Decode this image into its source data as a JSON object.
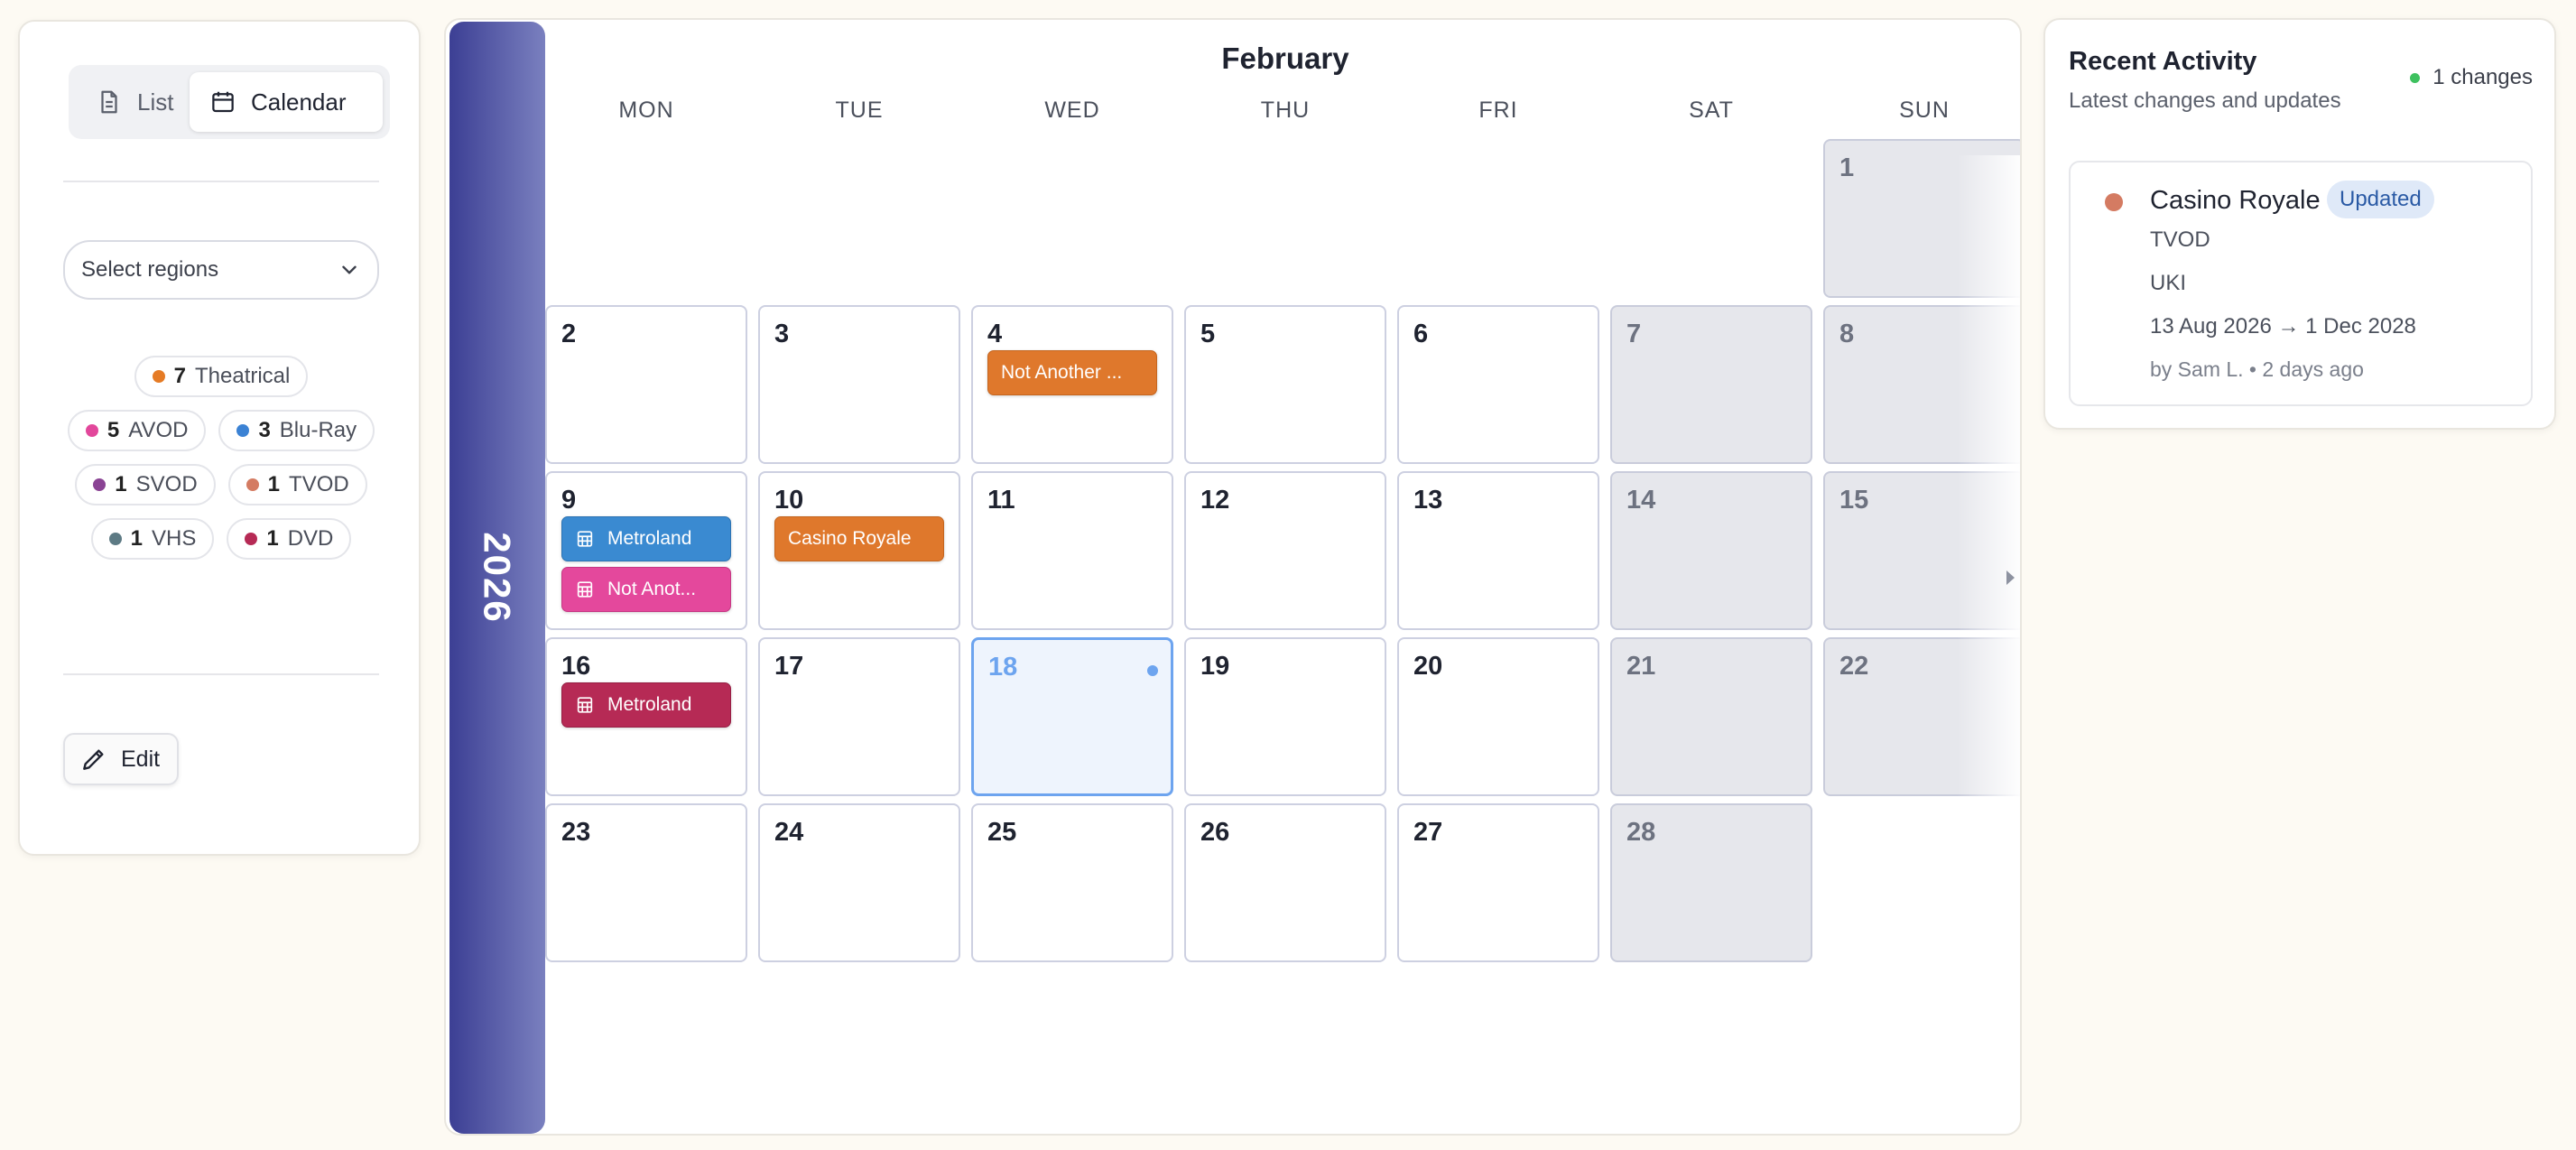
{
  "view_toggle": {
    "list_label": "List",
    "calendar_label": "Calendar",
    "active": "calendar"
  },
  "filters": {
    "region_placeholder": "Select regions",
    "legend": [
      {
        "count": "7",
        "label": "Theatrical",
        "color": "#e57b25"
      },
      {
        "count": "5",
        "label": "AVOD",
        "color": "#e2479b"
      },
      {
        "count": "3",
        "label": "Blu-Ray",
        "color": "#3b82d4"
      },
      {
        "count": "1",
        "label": "SVOD",
        "color": "#8a4394"
      },
      {
        "count": "1",
        "label": "TVOD",
        "color": "#d47b62"
      },
      {
        "count": "1",
        "label": "VHS",
        "color": "#5d7a84"
      },
      {
        "count": "1",
        "label": "DVD",
        "color": "#b62a55"
      }
    ],
    "edit_label": "Edit"
  },
  "calendar": {
    "year": "2026",
    "month": "February",
    "weekdays": [
      "MON",
      "TUE",
      "WED",
      "THU",
      "FRI",
      "SAT",
      "SUN"
    ],
    "today": 18,
    "days": [
      {
        "day": 1,
        "weekend": true,
        "events": []
      },
      {
        "day": 2,
        "weekend": false,
        "events": []
      },
      {
        "day": 3,
        "weekend": false,
        "events": []
      },
      {
        "day": 4,
        "weekend": false,
        "events": [
          {
            "title": "Not Another ...",
            "color": "orange",
            "icon": false
          }
        ]
      },
      {
        "day": 5,
        "weekend": false,
        "events": []
      },
      {
        "day": 6,
        "weekend": false,
        "events": []
      },
      {
        "day": 7,
        "weekend": true,
        "events": []
      },
      {
        "day": 8,
        "weekend": true,
        "events": []
      },
      {
        "day": 9,
        "weekend": false,
        "events": [
          {
            "title": "Metroland",
            "color": "blue",
            "icon": true
          },
          {
            "title": "Not Anot...",
            "color": "pink",
            "icon": true
          }
        ]
      },
      {
        "day": 10,
        "weekend": false,
        "events": [
          {
            "title": "Casino Royale",
            "color": "orange",
            "icon": false
          }
        ]
      },
      {
        "day": 11,
        "weekend": false,
        "events": []
      },
      {
        "day": 12,
        "weekend": false,
        "events": []
      },
      {
        "day": 13,
        "weekend": false,
        "events": []
      },
      {
        "day": 14,
        "weekend": true,
        "events": []
      },
      {
        "day": 15,
        "weekend": true,
        "events": []
      },
      {
        "day": 16,
        "weekend": false,
        "events": [
          {
            "title": "Metroland",
            "color": "crimson",
            "icon": true
          }
        ]
      },
      {
        "day": 17,
        "weekend": false,
        "events": []
      },
      {
        "day": 18,
        "weekend": false,
        "events": []
      },
      {
        "day": 19,
        "weekend": false,
        "events": []
      },
      {
        "day": 20,
        "weekend": false,
        "events": []
      },
      {
        "day": 21,
        "weekend": true,
        "events": []
      },
      {
        "day": 22,
        "weekend": true,
        "events": []
      },
      {
        "day": 23,
        "weekend": false,
        "events": []
      },
      {
        "day": 24,
        "weekend": false,
        "events": []
      },
      {
        "day": 25,
        "weekend": false,
        "events": []
      },
      {
        "day": 26,
        "weekend": false,
        "events": []
      },
      {
        "day": 27,
        "weekend": false,
        "events": []
      },
      {
        "day": 28,
        "weekend": true,
        "events": []
      }
    ]
  },
  "activity": {
    "title": "Recent Activity",
    "subtitle": "Latest changes and updates",
    "count_label": "1 changes",
    "item": {
      "name": "Casino Royale",
      "badge": "Updated",
      "type": "TVOD",
      "region": "UKI",
      "dates": "13 Aug 2026 → 1 Dec 2028",
      "meta": "by Sam L. • 2 days ago",
      "dot_color": "#d47b62"
    }
  }
}
